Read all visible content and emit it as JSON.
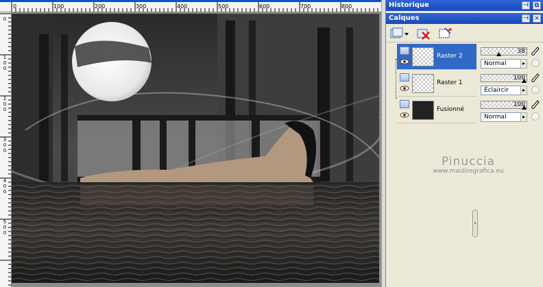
{
  "ruler": {
    "top_labels": [
      "0",
      "100",
      "200",
      "300",
      "400",
      "500",
      "600",
      "700",
      "800"
    ],
    "left_labels": [
      [
        "0"
      ],
      [
        "1",
        "0",
        "0"
      ],
      [
        "2",
        "0",
        "0"
      ],
      [
        "3",
        "0",
        "0"
      ],
      [
        "4",
        "0",
        "0"
      ],
      [
        "5",
        "0",
        "0"
      ]
    ]
  },
  "panels": {
    "historique": {
      "title": "Historique"
    },
    "calques": {
      "title": "Calques"
    }
  },
  "layers": [
    {
      "name": "Raster 2",
      "selected": true,
      "opacity": "38",
      "blend": "Normal",
      "opacity_fraction": 0.38
    },
    {
      "name": "Raster 1",
      "selected": false,
      "opacity": "100",
      "blend": "Éclaircir",
      "opacity_fraction": 1.0
    },
    {
      "name": "Fusionné",
      "selected": false,
      "opacity": "100",
      "blend": "Normal",
      "opacity_fraction": 1.0
    }
  ],
  "icons": {
    "new_layer": "new-layer-icon",
    "delete_layer": "delete-layer-icon",
    "mask": "mask-icon",
    "eye": "eye-icon",
    "brush": "brush-icon",
    "link": "link-icon"
  },
  "watermark": {
    "name": "Pinuccia",
    "site": "www.maidiregrafica.eu"
  },
  "colors": {
    "titlebar": "#2f66d6",
    "selection": "#3169c6",
    "ruler_accent": "#0a54c8"
  }
}
